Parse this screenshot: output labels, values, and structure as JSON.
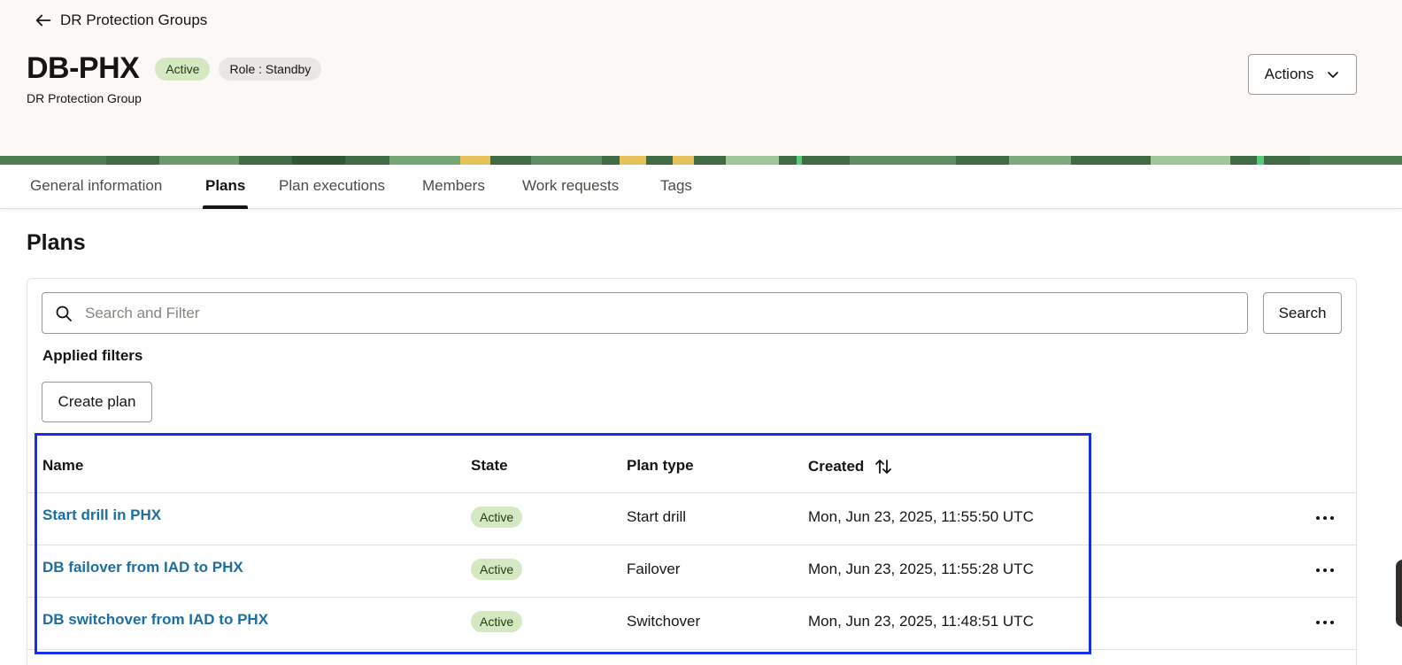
{
  "header": {
    "back_label": "DR Protection Groups",
    "title": "DB-PHX",
    "status_badge": "Active",
    "role_badge": "Role : Standby",
    "subtitle": "DR Protection Group",
    "actions_label": "Actions"
  },
  "tabs": [
    {
      "label": "General information"
    },
    {
      "label": "Plans",
      "active": true
    },
    {
      "label": "Plan executions"
    },
    {
      "label": "Members"
    },
    {
      "label": "Work requests"
    },
    {
      "label": "Tags"
    }
  ],
  "plans": {
    "section_title": "Plans",
    "search_placeholder": "Search and Filter",
    "search_button": "Search",
    "applied_filters_label": "Applied filters",
    "create_button": "Create plan",
    "columns": [
      "Name",
      "State",
      "Plan type",
      "Created"
    ],
    "rows": [
      {
        "name": "Start drill in PHX",
        "state": "Active",
        "plan_type": "Start drill",
        "created": "Mon, Jun 23, 2025, 11:55:50 UTC"
      },
      {
        "name": "DB failover from IAD to PHX",
        "state": "Active",
        "plan_type": "Failover",
        "created": "Mon, Jun 23, 2025, 11:55:28 UTC"
      },
      {
        "name": "DB switchover from IAD to PHX",
        "state": "Active",
        "plan_type": "Switchover",
        "created": "Mon, Jun 23, 2025, 11:48:51 UTC"
      }
    ]
  },
  "icons": {
    "back": "arrow-left-icon",
    "actions": "chevron-down-icon",
    "search": "search-icon",
    "sort": "sort-icon",
    "row_actions": "more-horizontal-icon"
  },
  "colors": {
    "active_badge_bg": "#d4e8c2",
    "link": "#1d6ea1",
    "highlight": "#1530e8",
    "header_bg": "#fbf9f8"
  }
}
